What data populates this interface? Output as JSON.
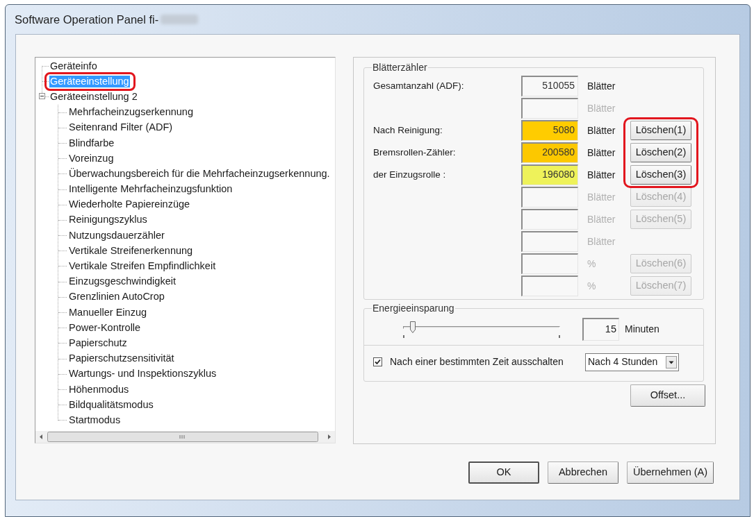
{
  "window": {
    "title": "Software Operation Panel fi-"
  },
  "tree": {
    "items": [
      {
        "label": "Geräteinfo",
        "selected": false,
        "highlighted": false
      },
      {
        "label": "Geräteeinstellung",
        "selected": true,
        "highlighted": true
      },
      {
        "label": "Geräteeinstellung 2",
        "selected": false,
        "highlighted": false,
        "expanded": true,
        "children": [
          {
            "label": "Mehrfacheinzugserkennung",
            "selected": false
          },
          {
            "label": "Seitenrand Filter (ADF)",
            "selected": false
          },
          {
            "label": "Blindfarbe",
            "selected": false
          },
          {
            "label": "Voreinzug",
            "selected": false
          },
          {
            "label": "Überwachungsbereich für die Mehrfacheinzugserkennung.",
            "selected": false
          },
          {
            "label": "Intelligente Mehrfacheinzugsfunktion",
            "selected": false
          },
          {
            "label": "Wiederholte Papiereinzüge",
            "selected": false
          },
          {
            "label": "Reinigungszyklus",
            "selected": false
          },
          {
            "label": "Nutzungsdauerzähler",
            "selected": false
          },
          {
            "label": "Vertikale Streifenerkennung",
            "selected": false
          },
          {
            "label": "Vertikale Streifen Empfindlichkeit",
            "selected": false
          },
          {
            "label": "Einzugsgeschwindigkeit",
            "selected": false
          },
          {
            "label": "Grenzlinien AutoCrop",
            "selected": false
          },
          {
            "label": "Manueller Einzug",
            "selected": false
          },
          {
            "label": "Power-Kontrolle",
            "selected": false
          },
          {
            "label": "Papierschutz",
            "selected": false
          },
          {
            "label": "Papierschutzsensitivität",
            "selected": false
          },
          {
            "label": "Wartungs- und Inspektionszyklus",
            "selected": false
          },
          {
            "label": "Höhenmodus",
            "selected": false
          },
          {
            "label": "Bildqualitätsmodus",
            "selected": false
          },
          {
            "label": "Startmodus",
            "selected": false
          }
        ]
      }
    ]
  },
  "counter": {
    "title": "Blätterzähler",
    "rows": [
      {
        "label": "Gesamtanzahl (ADF):",
        "value": "510055",
        "unit": "Blätter",
        "color": "#f8f8f8",
        "disabled": false
      },
      {
        "unit": "Blätter",
        "color": "#f8f8f8",
        "disabled": true
      },
      {
        "label": "Nach Reinigung:",
        "value": "5080",
        "unit": "Blätter",
        "color": "#ffcc00",
        "disabled": false,
        "button": {
          "label": "Löschen(1)",
          "highlighted": true
        }
      },
      {
        "label": "Bremsrollen-Zähler:",
        "value": "200580",
        "unit": "Blätter",
        "color": "#fcc800",
        "disabled": false,
        "button": {
          "label": "Löschen(2)",
          "highlighted": true
        }
      },
      {
        "label": "der Einzugsrolle :",
        "value": "196080",
        "unit": "Blätter",
        "color": "#eef25a",
        "disabled": false,
        "button": {
          "label": "Löschen(3)",
          "highlighted": true
        }
      },
      {
        "unit": "Blätter",
        "color": "#f8f8f8",
        "disabled": true,
        "button": {
          "label": "Löschen(4)",
          "highlighted": false
        }
      },
      {
        "unit": "Blätter",
        "color": "#f8f8f8",
        "disabled": true,
        "button": {
          "label": "Löschen(5)",
          "highlighted": false
        }
      },
      {
        "unit": "Blätter",
        "color": "#f8f8f8",
        "disabled": true
      },
      {
        "unit": "%",
        "color": "#f8f8f8",
        "disabled": true,
        "button": {
          "label": "Löschen(6)",
          "highlighted": false
        }
      },
      {
        "unit": "%",
        "color": "#f8f8f8",
        "disabled": true,
        "button": {
          "label": "Löschen(7)",
          "highlighted": false
        }
      }
    ]
  },
  "energy": {
    "title": "Energieeinsparung",
    "slider": {
      "level": 0.06
    },
    "minutes": {
      "value": "15",
      "unit": "Minuten"
    },
    "auto_off": {
      "label": "Nach einer bestimmten Zeit ausschalten",
      "checked": true
    },
    "dropdown": {
      "value": "Nach 4 Stunden"
    }
  },
  "offset_button": {
    "label": "Offset..."
  },
  "buttons": [
    {
      "label": "OK",
      "default": true
    },
    {
      "label": "Abbrechen",
      "default": false
    },
    {
      "label": "Übernehmen (A)",
      "default": false
    }
  ]
}
